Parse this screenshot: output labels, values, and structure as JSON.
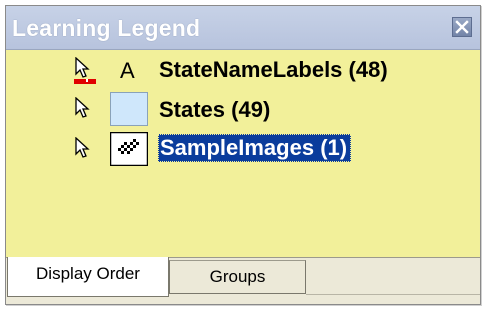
{
  "window": {
    "title": "Learning Legend",
    "title_bar_color": "#bccae2",
    "background_color": "#f2f09a"
  },
  "legend": {
    "items": [
      {
        "label": "StateNameLabels (48)",
        "symbol": "text-A",
        "selected": false,
        "pointer_icon": "arrow-pointer-with-red-underline"
      },
      {
        "label": "States (49)",
        "symbol": "light-blue-fill",
        "selected": false,
        "pointer_icon": "arrow-pointer",
        "symbol_color": "#cfe7fb"
      },
      {
        "label": "SampleImages (1)",
        "symbol": "point-image-pattern",
        "selected": true,
        "pointer_icon": "arrow-pointer"
      }
    ],
    "text_symbol_glyph": "A",
    "selection_color": "#0a3c9c"
  },
  "tabs": [
    {
      "label": "Display Order",
      "active": true
    },
    {
      "label": "Groups",
      "active": false
    }
  ]
}
